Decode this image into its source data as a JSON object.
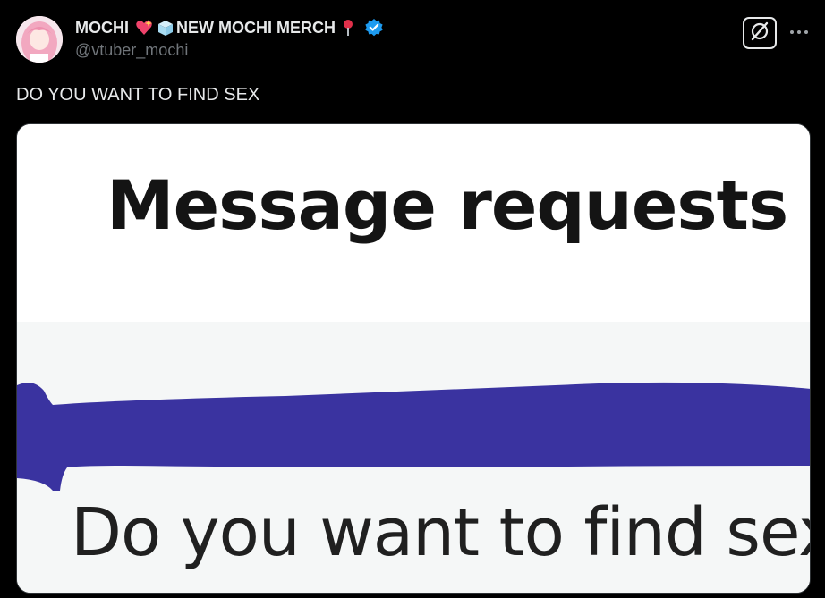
{
  "post": {
    "author": {
      "name_part1": "MOCHI",
      "name_part2": "NEW MOCHI MERCH",
      "name_emojis": [
        "sparkling-heart",
        "ice-cube",
        "round-pushpin"
      ],
      "handle": "@vtuber_mochi",
      "verified": true
    },
    "text": "DO YOU WANT TO FIND SEX",
    "actions": {
      "grok_icon": "grok-icon",
      "more_icon": "more-dots-icon"
    },
    "media": {
      "heading": "Message requests",
      "message": "Do you want to find sex"
    }
  },
  "colors": {
    "background": "#000000",
    "text_primary": "#e7e9ea",
    "text_secondary": "#71767b",
    "verified_blue": "#1d9bf0",
    "scribble_purple": "#3a33a0"
  }
}
